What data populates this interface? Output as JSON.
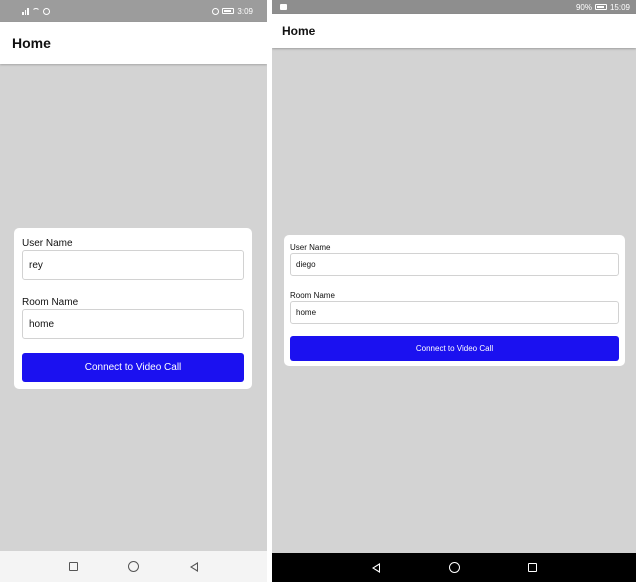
{
  "screens": [
    {
      "status": {
        "time": "3:09"
      },
      "appbar": {
        "title": "Home"
      },
      "form": {
        "user_label": "User Name",
        "user_value": "rey",
        "room_label": "Room Name",
        "room_value": "home",
        "button_label": "Connect to Video Call"
      }
    },
    {
      "status": {
        "battery": "90%",
        "time": "15:09"
      },
      "appbar": {
        "title": "Home"
      },
      "form": {
        "user_label": "User Name",
        "user_value": "diego",
        "room_label": "Room Name",
        "room_value": "home",
        "button_label": "Connect to Video Call"
      }
    }
  ],
  "colors": {
    "accent": "#1b11f0",
    "background": "#d3d3d3",
    "card": "#ffffff"
  },
  "icons": {
    "nav": [
      "square-icon",
      "circle-icon",
      "back-triangle-icon"
    ]
  }
}
